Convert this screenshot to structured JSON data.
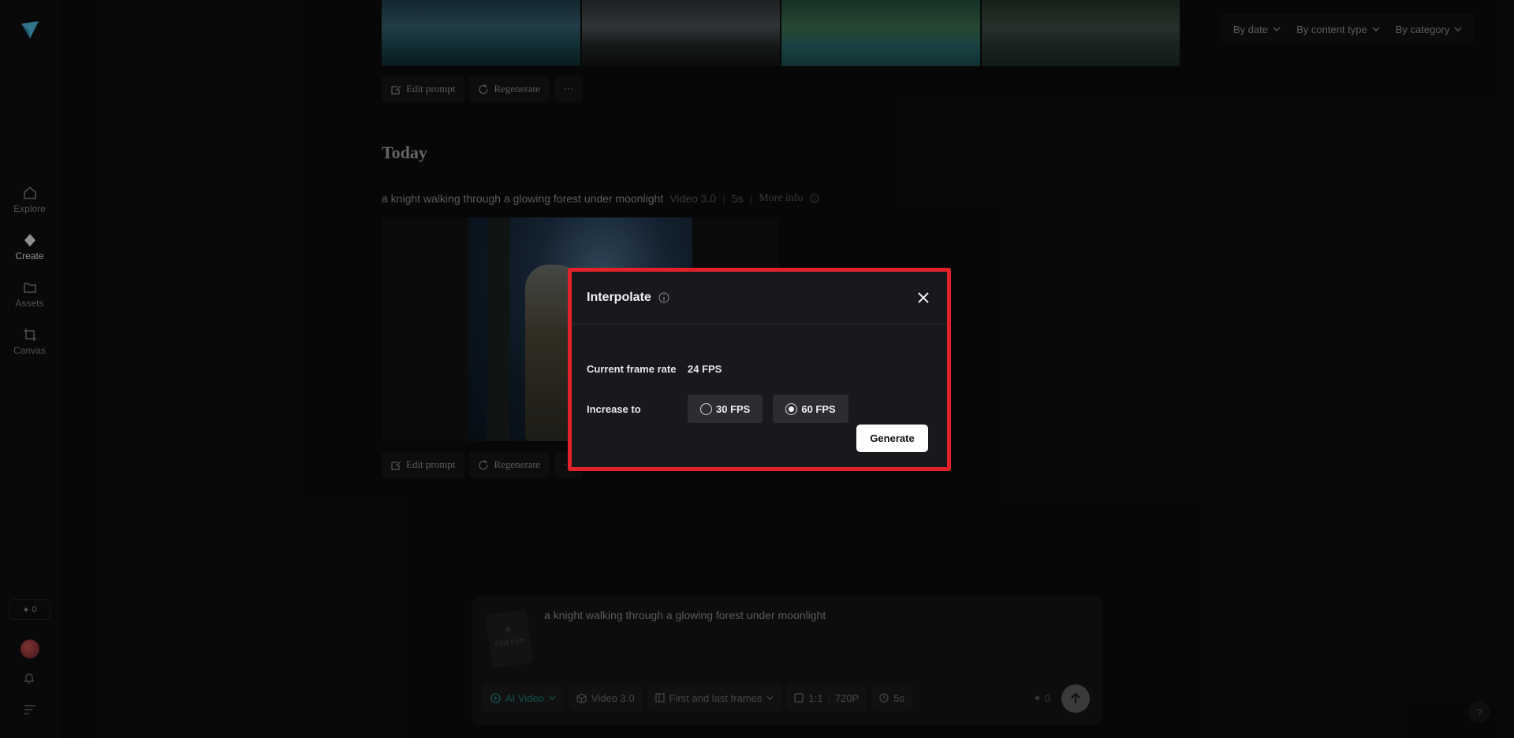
{
  "sidebar": {
    "items": [
      {
        "label": "Explore",
        "icon": "home-icon"
      },
      {
        "label": "Create",
        "icon": "diamond-icon"
      },
      {
        "label": "Assets",
        "icon": "folder-icon"
      },
      {
        "label": "Canvas",
        "icon": "crop-icon"
      }
    ],
    "credits": "0"
  },
  "filters": {
    "by_date": "By date",
    "by_content_type": "By content type",
    "by_category": "By category"
  },
  "actions": {
    "edit_prompt": "Edit prompt",
    "regenerate": "Regenerate",
    "more": "···"
  },
  "section": {
    "title": "Today"
  },
  "generation": {
    "prompt": "a knight walking through a glowing forest under moonlight",
    "model": "Video 3.0",
    "duration": "5s",
    "more_info": "More info"
  },
  "composer": {
    "first_frame": "First fram",
    "prompt": "a knight walking through a glowing forest under moonlight",
    "mode": "AI Video",
    "model": "Video 3.0",
    "frames_mode": "First and last frames",
    "ratio": "1:1",
    "resolution": "720P",
    "duration": "5s",
    "cost": "0"
  },
  "modal": {
    "title": "Interpolate",
    "current_label": "Current frame rate",
    "current_value": "24 FPS",
    "increase_label": "Increase to",
    "options": [
      {
        "label": "30 FPS",
        "selected": false
      },
      {
        "label": "60 FPS",
        "selected": true
      }
    ],
    "generate": "Generate"
  },
  "colors": {
    "highlight": "#e1222a",
    "accent": "#1f7f7b"
  }
}
